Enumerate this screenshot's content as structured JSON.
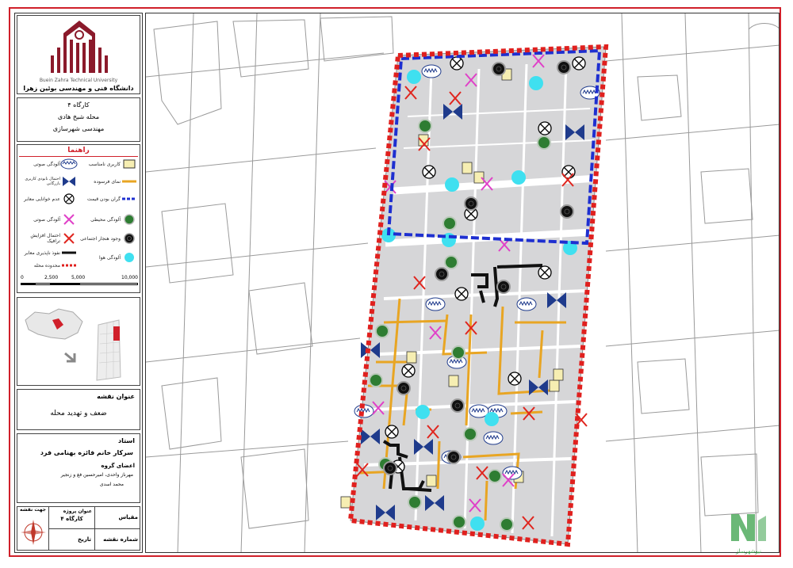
{
  "university": {
    "name_fa": "دانشگاه فنی و مهندسی بوئین زهرا",
    "name_en": "Buein Zahra Technical University",
    "logo_color": "#8b1a2b"
  },
  "project": {
    "workshop": "کارگاه ۴",
    "neighborhood": "محله شیخ هادی",
    "field": "مهندسی شهرسازی"
  },
  "legend": {
    "title": "راهنما",
    "title_color": "#d0202a",
    "items": [
      {
        "label": "کاربری نامناسب",
        "icon": "incompatible-landuse-square-icon"
      },
      {
        "label": "آلودگی صوتی",
        "icon": "noise-wave-ellipse-icon"
      },
      {
        "label": "نمای فرسوده",
        "icon": "worn-facade-line-icon"
      },
      {
        "label": "احتمال نابودی کاربری بازرگانی",
        "icon": "bowtie-icon"
      },
      {
        "label": "گران بودن قیمت",
        "icon": "high-price-dashed-line-icon"
      },
      {
        "label": "عدم خوانایی معابر",
        "icon": "circle-x-icon"
      },
      {
        "label": "آلودگی محیطی",
        "icon": "green-dot-icon"
      },
      {
        "label": "آلودگی صوتی",
        "icon": "magenta-x-icon"
      },
      {
        "label": "وجود هنجار اجتماعی",
        "icon": "black-dot-icon"
      },
      {
        "label": "احتمال افزایش ترافیک",
        "icon": "red-x-icon"
      },
      {
        "label": "آلودگی هوا",
        "icon": "cyan-dot-icon"
      },
      {
        "label": "نفوذ ناپذیری معابر",
        "icon": "black-line-icon"
      },
      {
        "label": "محدوده محله",
        "icon": "red-dashed-boundary-icon"
      }
    ],
    "colors": {
      "landuse": "#f6eeb2",
      "facade": "#e8a523",
      "bowtie": "#1f3b8c",
      "price": "#1e2fd0",
      "env": "#2e7d32",
      "magenta": "#e040c8",
      "red": "#e0251e",
      "cyan": "#3fe0f0",
      "boundary": "#e0201e"
    }
  },
  "scale": {
    "ticks": [
      "0",
      "2,500",
      "5,000",
      "10,000"
    ]
  },
  "map_title": {
    "label": "عنوان نقشه",
    "value": "ضعف و تهدید محله"
  },
  "instructor": {
    "label": "استاد",
    "value": "سرکار خانم فائزه بهنامی فرد"
  },
  "members": {
    "label": "اعضای گروه",
    "names": "مهرناز واحدی، امیرحسین فغ و زنجیر",
    "extra": "محمد اسدی"
  },
  "footer": {
    "north_label": "جهت نقشه",
    "project_title_label": "عنوان پروژه",
    "project_title_value": "کارگاه ۴",
    "scale_label": "مقیاس",
    "date_label": "تاریخ",
    "map_number_label": "شماره نقشه"
  },
  "watermark": {
    "text": "نیوشهرساز",
    "color": "#3aa04a"
  }
}
